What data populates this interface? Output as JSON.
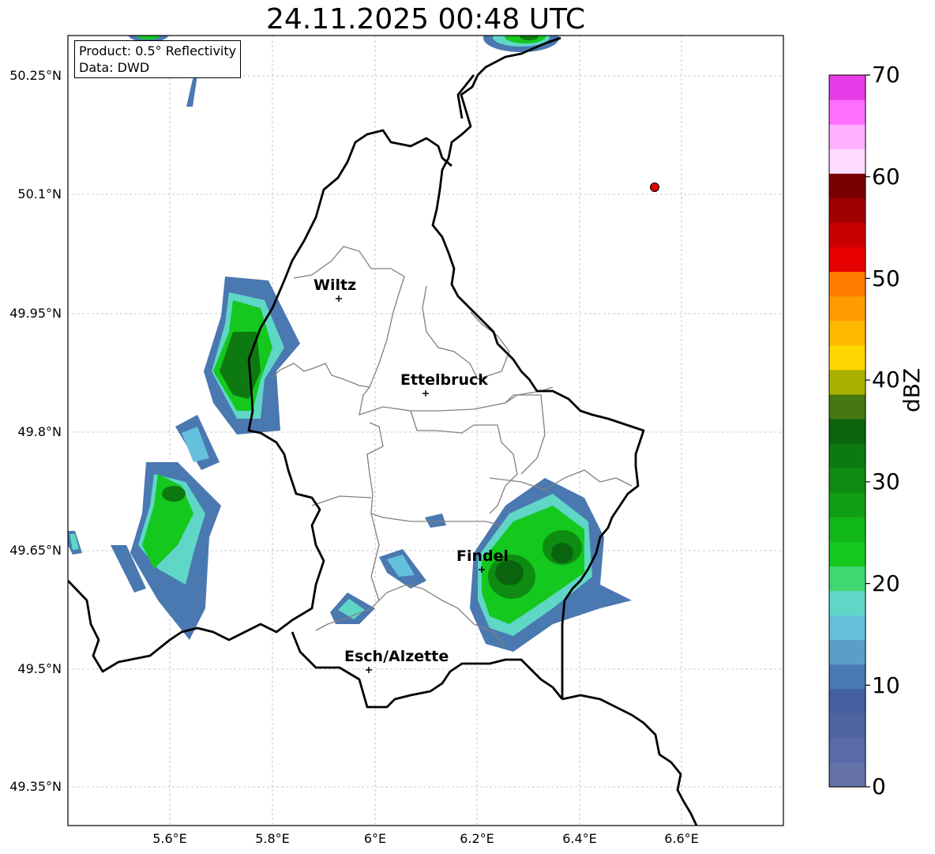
{
  "title": "24.11.2025 00:48 UTC",
  "info_box": {
    "product": "Product: 0.5° Reflectivity",
    "data_source": "Data: DWD"
  },
  "lat_labels": [
    "50.25°N",
    "50.1°N",
    "49.95°N",
    "49.8°N",
    "49.65°N",
    "49.5°N",
    "49.35°N"
  ],
  "lon_labels": [
    "5.6°E",
    "5.8°E",
    "6°E",
    "6.2°E",
    "6.4°E",
    "6.6°E"
  ],
  "cities": [
    {
      "name": "Wiltz"
    },
    {
      "name": "Ettelbruck"
    },
    {
      "name": "Findel"
    },
    {
      "name": "Esch/Alzette"
    }
  ],
  "colorbar": {
    "unit": "dBZ",
    "tick_labels": [
      "70",
      "60",
      "50",
      "40",
      "30",
      "20",
      "10",
      "0"
    ],
    "range": [
      0,
      70
    ],
    "colors": [
      "#6472a8",
      "#5a6aa6",
      "#4f63a3",
      "#4560a0",
      "#4a78b0",
      "#5b9fc8",
      "#65c0dc",
      "#5fd6c6",
      "#3fd772",
      "#14c81e",
      "#12b818",
      "#109e14",
      "#0e8c12",
      "#0c7a10",
      "#0a640e",
      "#457812",
      "#a8b000",
      "#ffd700",
      "#ffb800",
      "#ff9c00",
      "#ff7c00",
      "#e60000",
      "#c80000",
      "#a00000",
      "#7a0000",
      "#ffdcff",
      "#ffb0ff",
      "#ff6eff",
      "#e83ce8"
    ]
  },
  "colors": {
    "radar_marker": "#e00000",
    "border": "#000000",
    "district": "#808080"
  }
}
